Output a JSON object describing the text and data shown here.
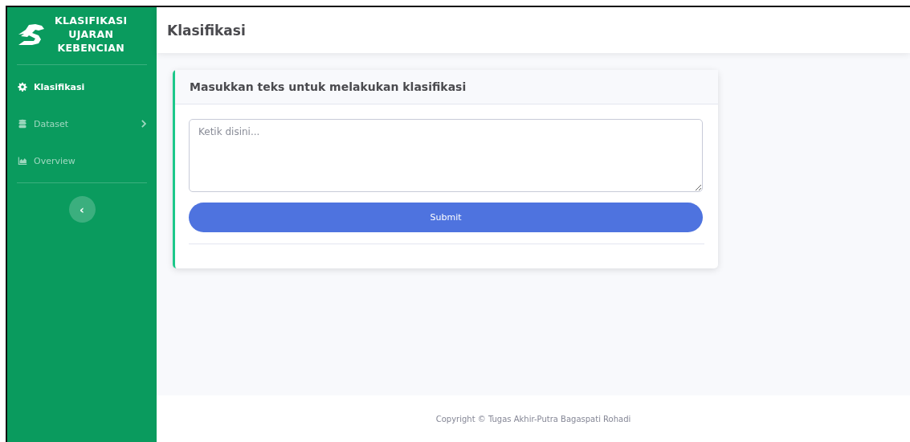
{
  "sidebar": {
    "brand": {
      "lines": [
        "KLASIFIKASI",
        "UJARAN",
        "KEBENCIAN"
      ]
    },
    "items": [
      {
        "label": "Klasifikasi",
        "kind": "gear",
        "selected": true,
        "submenu": false
      },
      {
        "label": "Dataset",
        "kind": "database",
        "selected": false,
        "submenu": true
      },
      {
        "label": "Overview",
        "kind": "chart",
        "selected": false,
        "submenu": false
      }
    ],
    "toggle": {
      "glyph": "‹"
    }
  },
  "topbar": {
    "title": "Klasifikasi"
  },
  "card": {
    "title": "Masukkan teks untuk melakukan klasifikasi",
    "input": {
      "placeholder": "Ketik disini..."
    },
    "button": "Submit"
  },
  "footer": "Copyright © Tugas Akhir-Putra Bagaspati Rohadi"
}
